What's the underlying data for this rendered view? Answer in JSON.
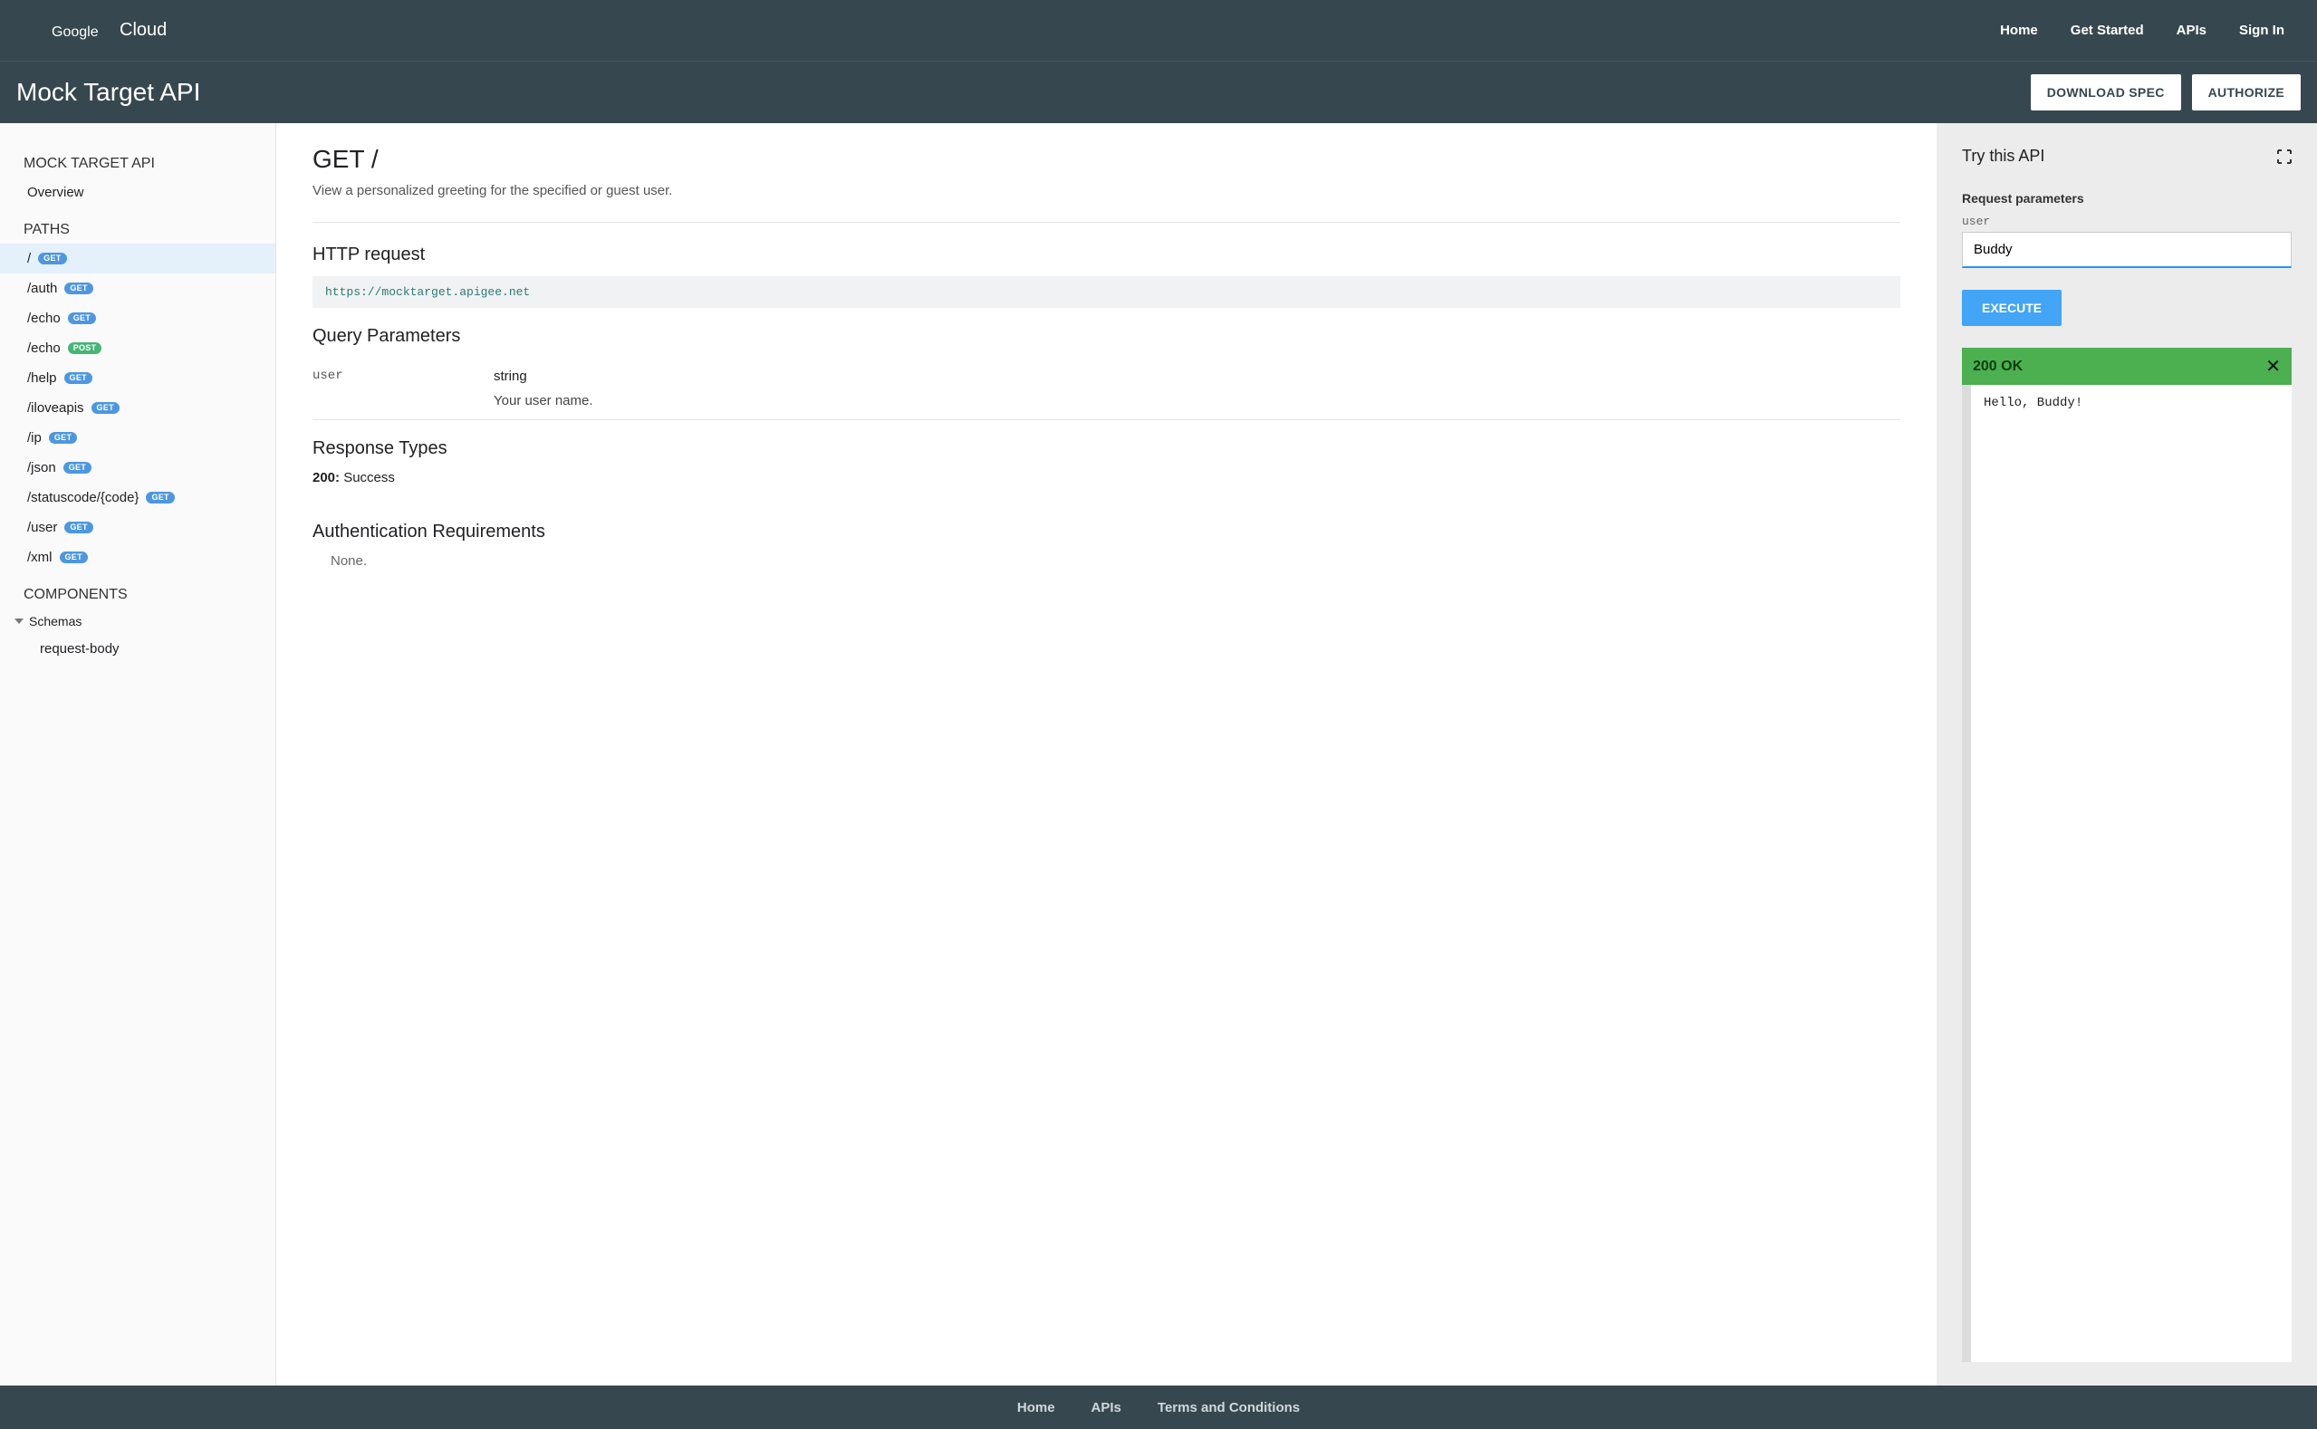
{
  "topbar": {
    "logo_text": "Google Cloud",
    "nav": {
      "home": "Home",
      "get_started": "Get Started",
      "apis": "APIs",
      "sign_in": "Sign In"
    }
  },
  "titlebar": {
    "title": "Mock Target API",
    "download": "DOWNLOAD SPEC",
    "authorize": "AUTHORIZE"
  },
  "sidebar": {
    "api_heading": "MOCK TARGET API",
    "overview": "Overview",
    "paths_heading": "PATHS",
    "paths": [
      {
        "path": "/",
        "method": "GET",
        "active": true
      },
      {
        "path": "/auth",
        "method": "GET"
      },
      {
        "path": "/echo",
        "method": "GET"
      },
      {
        "path": "/echo",
        "method": "POST"
      },
      {
        "path": "/help",
        "method": "GET"
      },
      {
        "path": "/iloveapis",
        "method": "GET"
      },
      {
        "path": "/ip",
        "method": "GET"
      },
      {
        "path": "/json",
        "method": "GET"
      },
      {
        "path": "/statuscode/{code}",
        "method": "GET"
      },
      {
        "path": "/user",
        "method": "GET"
      },
      {
        "path": "/xml",
        "method": "GET"
      }
    ],
    "components_heading": "COMPONENTS",
    "schemas_label": "Schemas",
    "request_body_label": "request-body"
  },
  "content": {
    "heading": "GET /",
    "description": "View a personalized greeting for the specified or guest user.",
    "http_request_heading": "HTTP request",
    "http_url": "https://mocktarget.apigee.net",
    "query_params_heading": "Query Parameters",
    "param_name": "user",
    "param_type": "string",
    "param_desc": "Your user name.",
    "response_types_heading": "Response Types",
    "response_code": "200:",
    "response_label": " Success",
    "auth_heading": "Authentication Requirements",
    "auth_none": "None."
  },
  "right": {
    "try_label": "Try this API",
    "req_params_label": "Request parameters",
    "user_label": "user",
    "user_value": "Buddy",
    "execute": "EXECUTE",
    "status": "200 OK",
    "response_body": "Hello, Buddy!"
  },
  "footer": {
    "home": "Home",
    "apis": "APIs",
    "terms": "Terms and Conditions"
  }
}
